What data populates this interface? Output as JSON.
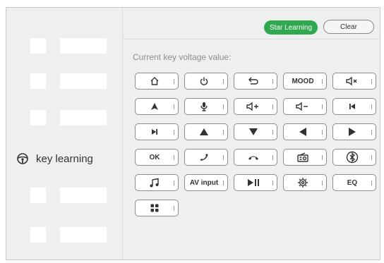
{
  "sidebar": {
    "active_label": "key learning",
    "active_icon": "steering-wheel-icon"
  },
  "toolbar": {
    "start_label": "Star Learning",
    "clear_label": "Clear"
  },
  "main": {
    "voltage_label": "Current key voltage value:"
  },
  "keys": [
    {
      "name": "home",
      "icon": "home-icon",
      "text": ""
    },
    {
      "name": "power",
      "icon": "power-icon",
      "text": ""
    },
    {
      "name": "back",
      "icon": "back-icon",
      "text": ""
    },
    {
      "name": "mood",
      "icon": "",
      "text": "MOOD"
    },
    {
      "name": "mute",
      "icon": "mute-icon",
      "text": ""
    },
    {
      "name": "nav",
      "icon": "navigation-icon",
      "text": ""
    },
    {
      "name": "mic",
      "icon": "microphone-icon",
      "text": ""
    },
    {
      "name": "vol-up",
      "icon": "volume-up-icon",
      "text": ""
    },
    {
      "name": "vol-down",
      "icon": "volume-down-icon",
      "text": ""
    },
    {
      "name": "prev",
      "icon": "previous-icon",
      "text": ""
    },
    {
      "name": "next",
      "icon": "next-icon",
      "text": ""
    },
    {
      "name": "up",
      "icon": "up-arrow-icon",
      "text": ""
    },
    {
      "name": "down",
      "icon": "down-arrow-icon",
      "text": ""
    },
    {
      "name": "left",
      "icon": "left-arrow-icon",
      "text": ""
    },
    {
      "name": "right",
      "icon": "right-arrow-icon",
      "text": ""
    },
    {
      "name": "ok",
      "icon": "",
      "text": "OK"
    },
    {
      "name": "phone-answer",
      "icon": "phone-answer-icon",
      "text": ""
    },
    {
      "name": "phone-hangup",
      "icon": "phone-hangup-icon",
      "text": ""
    },
    {
      "name": "radio",
      "icon": "radio-icon",
      "text": ""
    },
    {
      "name": "bluetooth",
      "icon": "bluetooth-icon",
      "text": ""
    },
    {
      "name": "music",
      "icon": "music-icon",
      "text": ""
    },
    {
      "name": "av-input",
      "icon": "",
      "text": "AV input"
    },
    {
      "name": "play-pause",
      "icon": "play-pause-icon",
      "text": ""
    },
    {
      "name": "settings",
      "icon": "settings-icon",
      "text": ""
    },
    {
      "name": "eq",
      "icon": "",
      "text": "EQ"
    },
    {
      "name": "apps",
      "icon": "apps-grid-icon",
      "text": ""
    }
  ],
  "colors": {
    "start_button": "#2fa84f",
    "panel_bg": "#eef0f0",
    "key_border": "#8d8d8d"
  }
}
